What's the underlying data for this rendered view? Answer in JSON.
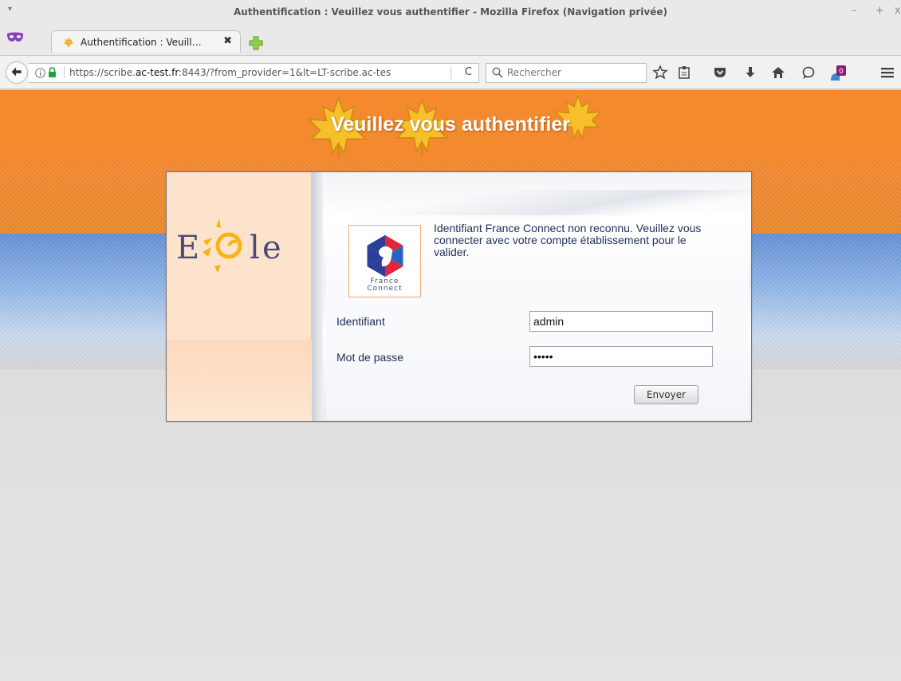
{
  "window": {
    "title": "Authentification : Veuillez vous authentifier - Mozilla Firefox (Navigation privée)",
    "menu_glyph": "▾",
    "controls": {
      "minimize": "–",
      "maximize": "+",
      "close": "x"
    }
  },
  "tabs": [
    {
      "title": "Authentification : Veuill…",
      "close_glyph": "✖",
      "active": true
    }
  ],
  "navbar": {
    "url_prefix": "https://scribe.",
    "url_domain": "ac-test.fr",
    "url_suffix": ":8443/?from_provider=1&lt=LT-scribe.ac-tes",
    "reload_glyph": "C",
    "search_placeholder": "Rechercher",
    "notification_count": "0"
  },
  "page": {
    "title": "Veuillez vous authentifier",
    "logo_text": "Eole",
    "france_connect": {
      "line1": "France",
      "line2": "Connect"
    },
    "message": "Identifiant France Connect non reconnu. Veuillez vous connecter avec votre compte établissement pour le valider.",
    "username_label": "Identifiant",
    "username_value": "admin",
    "password_label": "Mot de passe",
    "password_value": "admin",
    "submit_label": "Envoyer"
  },
  "colors": {
    "orange": "#f58a2e",
    "blue": "#5f8ed6",
    "text_navy": "#23305e",
    "fc_border": "#f3a96c"
  }
}
